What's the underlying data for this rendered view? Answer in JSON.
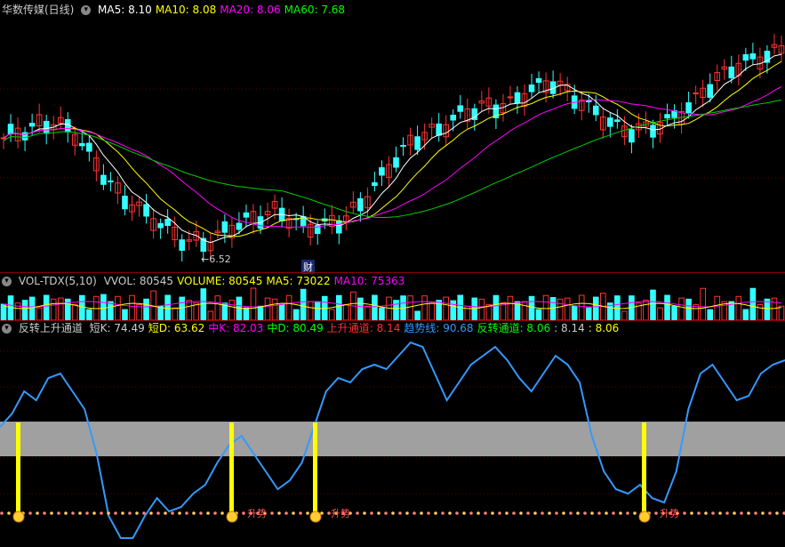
{
  "main": {
    "title": "华数传媒(日线)",
    "ma": [
      {
        "label": "MA5: 8.10",
        "color": "#ffffff"
      },
      {
        "label": "MA10: 8.08",
        "color": "#ffff00"
      },
      {
        "label": "MA20: 8.06",
        "color": "#ff00ff"
      },
      {
        "label": "MA60: 7.68",
        "color": "#00ff00"
      }
    ],
    "low_marker": "6.52",
    "fin_badge": "财"
  },
  "volume": {
    "title": "VOL-TDX(5,10)",
    "items": [
      {
        "label": "VVOL: 80545",
        "color": "#cccccc"
      },
      {
        "label": "VOLUME: 80545",
        "color": "#ffff00"
      },
      {
        "label": "MA5: 73022",
        "color": "#ffff00"
      },
      {
        "label": "MA10: 75363",
        "color": "#ff00ff"
      }
    ]
  },
  "indicator": {
    "title": "反转上升通道",
    "items": [
      {
        "label": "短K: 74.49",
        "color": "#cccccc"
      },
      {
        "label": "短D: 63.62",
        "color": "#ffff00"
      },
      {
        "label": "中K: 82.03",
        "color": "#ff00ff"
      },
      {
        "label": "中D: 80.49",
        "color": "#00ff00"
      },
      {
        "label": "上升通道: 8.14",
        "color": "#ff3030"
      },
      {
        "label": "趋势线: 90.68",
        "color": "#3399ff"
      },
      {
        "label": "反转通道: 8.06",
        "color": "#00ff00"
      },
      {
        "label": ": 8.14",
        "color": "#cccccc"
      },
      {
        "label": ": 8.06",
        "color": "#ffff00"
      }
    ],
    "signal_label": "升势"
  },
  "colors": {
    "up": "#ff3333",
    "down": "#33ffff",
    "ma5": "#ffffff",
    "ma10": "#ffff00",
    "ma20": "#ff00ff",
    "ma60": "#00cc00",
    "trend": "#3399ff",
    "band": "#a0a0a0"
  }
}
